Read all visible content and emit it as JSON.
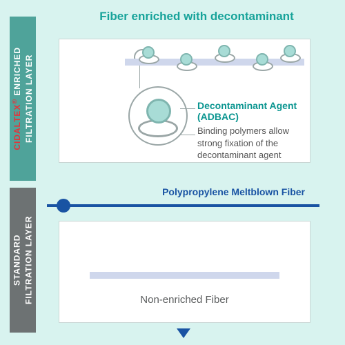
{
  "title_enriched": "Fiber enriched with decontaminant",
  "sidebar": {
    "top": {
      "brand": "CIDALTEX",
      "reg": "®",
      "suffix": " ENRICHED",
      "line2": "FILTRATION LAYER"
    },
    "bottom": {
      "line1": "STANDARD",
      "line2": "FILTRATION LAYER"
    }
  },
  "agent": {
    "name": "Decontaminant Agent",
    "code": "(ADBAC)",
    "desc": "Binding polymers allow strong fixation of the decontaminant agent"
  },
  "divider_label": "Polypropylene Meltblown Fiber",
  "non_enriched_label": "Non-enriched Fiber"
}
